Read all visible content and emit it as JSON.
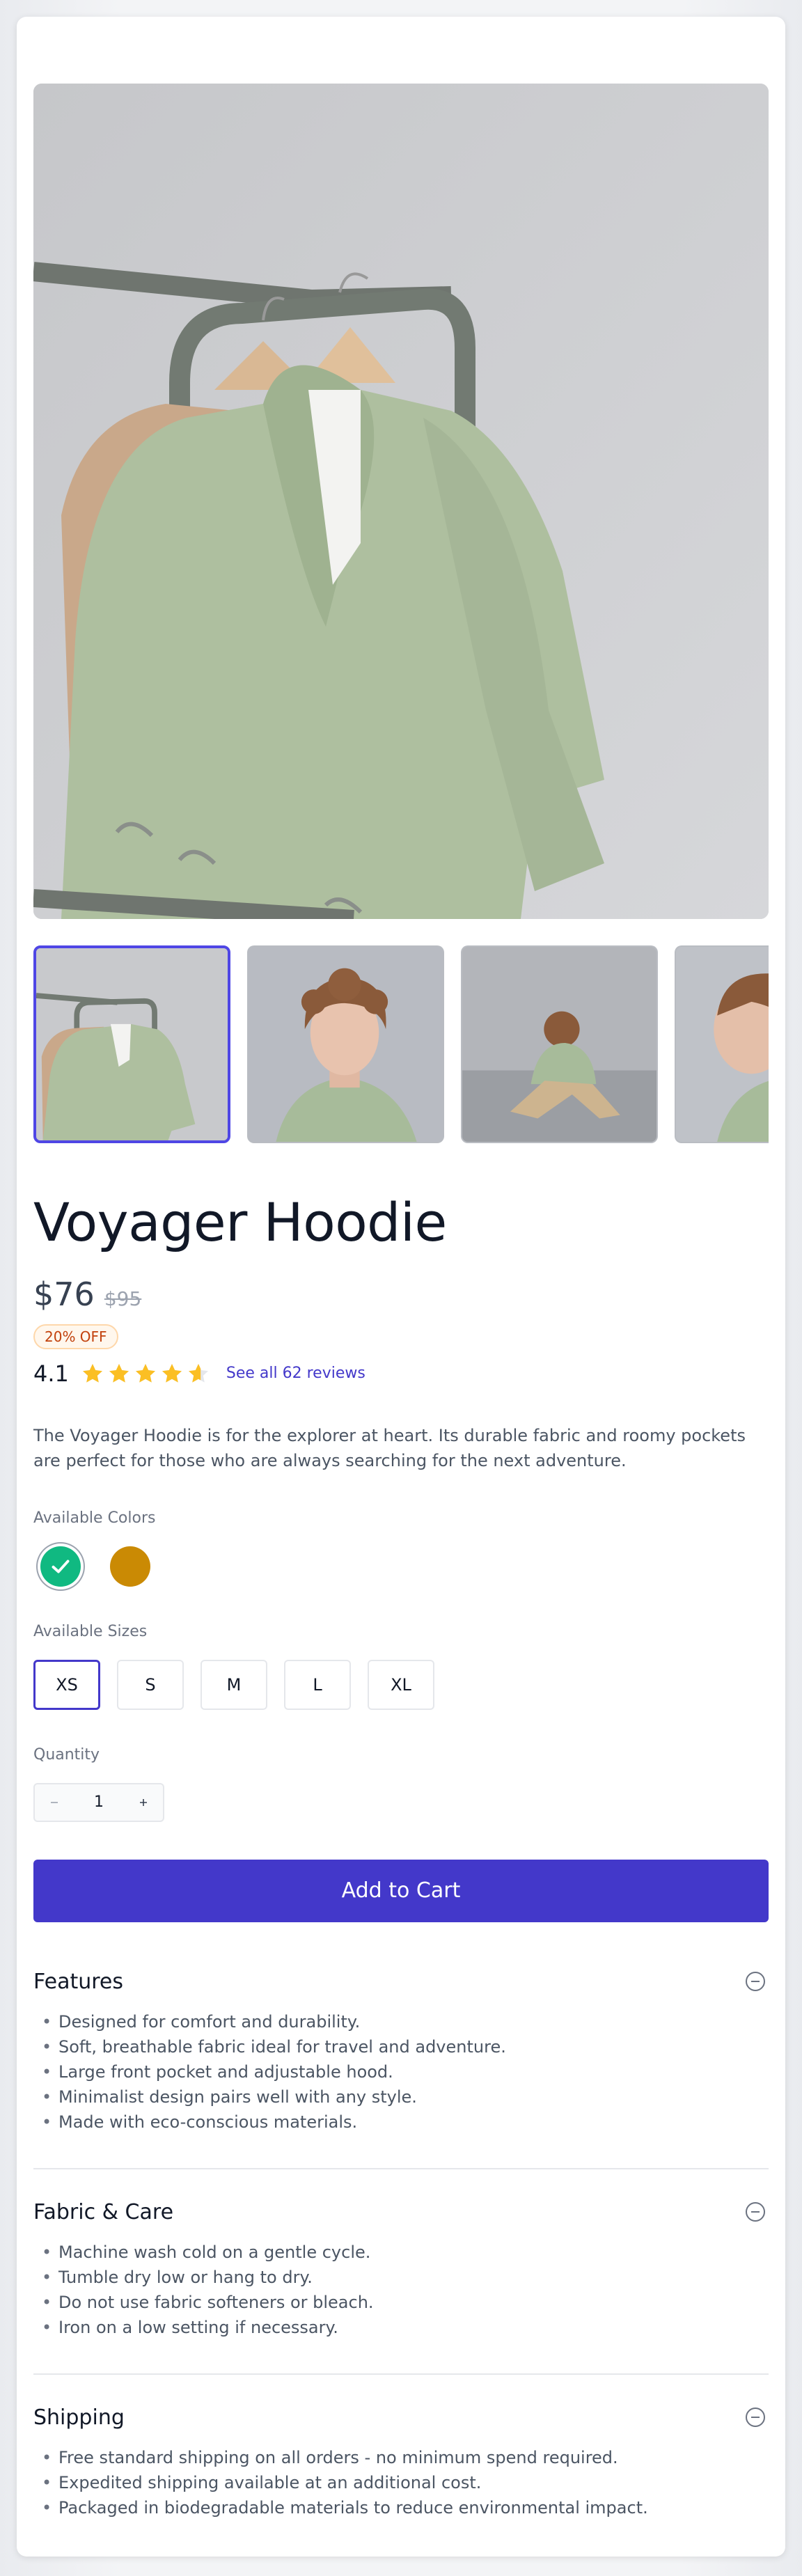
{
  "product": {
    "title": "Voyager Hoodie",
    "price": "$76",
    "old_price": "$95",
    "discount_badge": "20% OFF",
    "rating": "4.1",
    "rating_value": 4.1,
    "rating_max": 5,
    "reviews_link": "See all 62 reviews",
    "description": "The Voyager Hoodie is for the explorer at heart. Its durable fabric and roomy pockets are perfect for those who are always searching for the next adventure."
  },
  "gallery": {
    "selected_index": 0,
    "thumbnails": [
      {
        "name": "hoodie-on-rack"
      },
      {
        "name": "model-portrait"
      },
      {
        "name": "model-seated"
      },
      {
        "name": "model-profile"
      }
    ]
  },
  "colors": {
    "label": "Available Colors",
    "options": [
      {
        "hex": "#10b981",
        "selected": true
      },
      {
        "hex": "#ca8a04",
        "selected": false
      }
    ]
  },
  "sizes": {
    "label": "Available Sizes",
    "options": [
      "XS",
      "S",
      "M",
      "L",
      "XL"
    ],
    "selected": "XS"
  },
  "quantity": {
    "label": "Quantity",
    "value": "1",
    "decrement_icon": "minus-icon",
    "increment_icon": "plus-icon"
  },
  "cart": {
    "button_label": "Add to Cart"
  },
  "accordion": [
    {
      "title": "Features",
      "items": [
        "Designed for comfort and durability.",
        "Soft, breathable fabric ideal for travel and adventure.",
        "Large front pocket and adjustable hood.",
        "Minimalist design pairs well with any style.",
        "Made with eco-conscious materials."
      ]
    },
    {
      "title": "Fabric & Care",
      "items": [
        "Machine wash cold on a gentle cycle.",
        "Tumble dry low or hang to dry.",
        "Do not use fabric softeners or bleach.",
        "Iron on a low setting if necessary."
      ]
    },
    {
      "title": "Shipping",
      "items": [
        "Free standard shipping on all orders - no minimum spend required.",
        "Expedited shipping available at an additional cost.",
        "Packaged in biodegradable materials to reduce environmental impact."
      ]
    }
  ],
  "theme": {
    "accent": "#4338ca",
    "star": "#fbbf24",
    "badge_text": "#c2410c"
  }
}
